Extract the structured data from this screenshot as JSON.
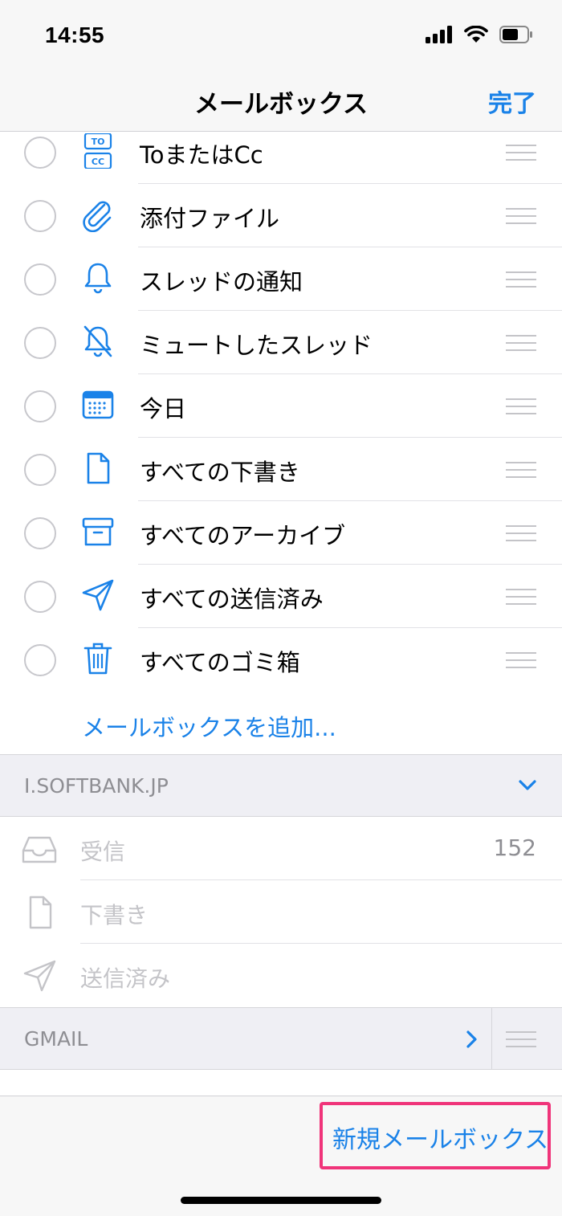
{
  "status": {
    "time": "14:55"
  },
  "nav": {
    "title": "メールボックス",
    "done_label": "完了"
  },
  "mailboxes": [
    {
      "label": "ToまたはCc",
      "icon": "to-cc-icon"
    },
    {
      "label": "添付ファイル",
      "icon": "paperclip-icon"
    },
    {
      "label": "スレッドの通知",
      "icon": "bell-icon"
    },
    {
      "label": "ミュートしたスレッド",
      "icon": "bell-slash-icon"
    },
    {
      "label": "今日",
      "icon": "calendar-icon"
    },
    {
      "label": "すべての下書き",
      "icon": "document-icon"
    },
    {
      "label": "すべてのアーカイブ",
      "icon": "archive-box-icon"
    },
    {
      "label": "すべての送信済み",
      "icon": "paper-plane-icon"
    },
    {
      "label": "すべてのゴミ箱",
      "icon": "trash-icon"
    }
  ],
  "add_mailbox_label": "メールボックスを追加...",
  "accounts": [
    {
      "name": "I.SOFTBANK.JP",
      "expanded": true,
      "folders": [
        {
          "label": "受信",
          "count": "152",
          "icon": "inbox-tray-icon"
        },
        {
          "label": "下書き",
          "count": "",
          "icon": "document-icon"
        },
        {
          "label": "送信済み",
          "count": "",
          "icon": "paper-plane-icon"
        }
      ]
    },
    {
      "name": "GMAIL",
      "expanded": false
    }
  ],
  "toolbar": {
    "new_mailbox_label": "新規メールボックス"
  },
  "colors": {
    "accent": "#1a82e8",
    "highlight": "#f0347a",
    "secondary_text": "#8e8e93"
  }
}
